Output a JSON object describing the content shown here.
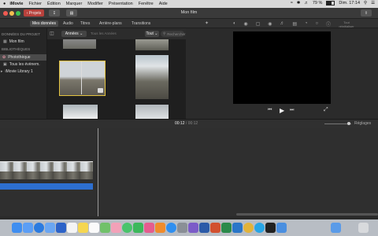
{
  "menubar": {
    "apple": "",
    "app": "iMovie",
    "items": [
      "Fichier",
      "Édition",
      "Marquer",
      "Modifier",
      "Présentation",
      "Fenêtre",
      "Aide"
    ],
    "battery": "79 %",
    "clock": "Dim. 17:14"
  },
  "titlebar": {
    "back_label": "Projets",
    "title": "Mon film"
  },
  "toolbar": {
    "tabs": [
      "Mes données",
      "Audio",
      "Titres",
      "Arrière-plans",
      "Transitions"
    ]
  },
  "sidebar": {
    "project_header": "DONNÉES DU PROJET",
    "project_item": "Mon film",
    "libraries_header": "BIBLIOTHÈQUES",
    "items": [
      "Photothèque",
      "Tous les évènem.",
      "iMovie Library 1"
    ]
  },
  "browser": {
    "filter_label": "Années",
    "filter_secondary": "Tous les Années",
    "all_label": "Tout",
    "search_placeholder": "Rechercher"
  },
  "viewer": {
    "overlay": "Tout réinitialiser"
  },
  "timeline": {
    "time_current": "00:12",
    "time_total": "00:12",
    "settings_label": "Réglages"
  },
  "colors": {
    "accent_yellow": "#e3c341",
    "audio_blue": "#2d6fd0",
    "back_button": "#b8413c"
  },
  "icons": [
    "apple-icon",
    "wifi-icon",
    "bluetooth-icon",
    "volume-icon",
    "battery-icon",
    "search-icon",
    "gear-icon",
    "play-icon",
    "skip-back-icon",
    "skip-forward-icon",
    "fullscreen-icon",
    "magic-wand-icon",
    "crop-icon",
    "color-icon",
    "stabilize-icon",
    "volume-adjust-icon",
    "speed-icon",
    "info-icon",
    "sidebar-toggle-icon",
    "share-icon"
  ],
  "dock": {
    "apps": [
      "Finder",
      "Launchpad",
      "Safari",
      "Mail",
      "Contacts",
      "Calendrier",
      "Notes",
      "Rappels",
      "Plans",
      "Photos",
      "Messages",
      "FaceTime",
      "iTunes",
      "iBooks",
      "App Store",
      "Préférences Système",
      "iMovie",
      "Word",
      "PowerPoint",
      "Excel",
      "Outlook",
      "Chrome",
      "Skype",
      "Terminal",
      "Utilitaires",
      "Téléchargements",
      "Corbeille"
    ]
  }
}
